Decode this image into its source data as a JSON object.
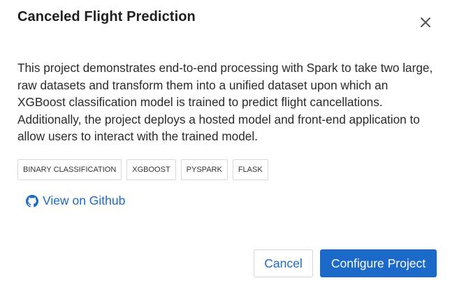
{
  "dialog": {
    "title": "Canceled Flight Prediction",
    "description": "This project demonstrates end-to-end processing with Spark to take two large, raw datasets and transform them into a unified dataset upon which an XGBoost classification model is trained to predict flight cancellations. Additionally, the project deploys a hosted model and front-end application to allow users to interact with the trained model.",
    "tags": [
      "BINARY CLASSIFICATION",
      "XGBOOST",
      "PYSPARK",
      "FLASK"
    ],
    "github_link_label": "View on Github",
    "cancel_label": "Cancel",
    "configure_label": "Configure Project"
  },
  "icons": {
    "close": "close-icon",
    "github": "github-icon"
  },
  "colors": {
    "accent": "#1b6ac9",
    "title_text": "#1f1f1f",
    "tag_border": "#d9d9d9"
  }
}
